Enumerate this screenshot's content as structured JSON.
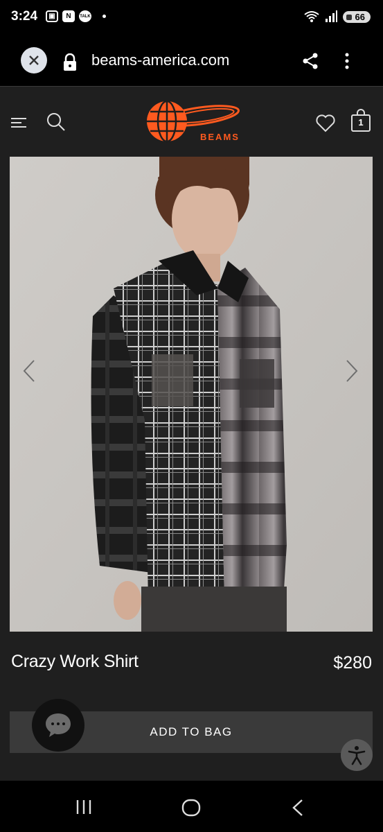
{
  "status_bar": {
    "time": "3:24",
    "icons": [
      "photo-icon",
      "naver-icon",
      "talk-icon"
    ],
    "notif_labels": [
      "N",
      "TALK"
    ],
    "battery": "66"
  },
  "browser": {
    "url": "beams-america.com"
  },
  "header": {
    "logo_text": "BEAMS",
    "bag_count": "1"
  },
  "product": {
    "name": "Crazy Work Shirt",
    "price": "$280",
    "add_to_bag_label": "ADD TO BAG"
  },
  "colors": {
    "accent": "#ff5a1f",
    "background": "#1f1f1f",
    "button": "#3a3a3a"
  }
}
